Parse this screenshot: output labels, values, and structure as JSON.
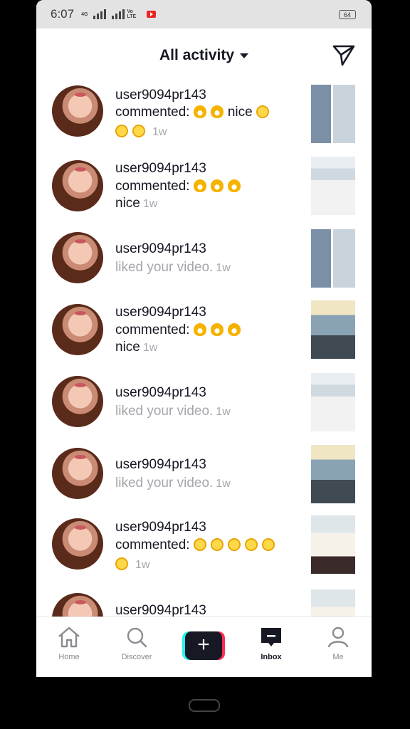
{
  "status_bar": {
    "time": "6:07",
    "network_4g": "4G",
    "volte": "Vo LTE",
    "battery": "64"
  },
  "header": {
    "title": "All activity",
    "icons": [
      "caret-down-icon",
      "send-direct-message-icon"
    ]
  },
  "activities": [
    {
      "username": "user9094pr143",
      "line1": "commented: 👌👌nice 🤣",
      "line2": "🤣🤣",
      "time": "1w"
    },
    {
      "username": "user9094pr143",
      "line1": "commented: 👌👌👌",
      "line2": "nice",
      "time": "1w"
    },
    {
      "username": "user9094pr143",
      "line1": "liked your video.",
      "line2": "",
      "time": "1w"
    },
    {
      "username": "user9094pr143",
      "line1": "commented: 👌👌👌",
      "line2": "nice",
      "time": "1w"
    },
    {
      "username": "user9094pr143",
      "line1": "liked your video.",
      "line2": "",
      "time": "1w"
    },
    {
      "username": "user9094pr143",
      "line1": "liked your video.",
      "line2": "",
      "time": "1w"
    },
    {
      "username": "user9094pr143",
      "line1": "commented: 🤣🤣🤣🤣🤣",
      "line2": "🤣",
      "time": "1w"
    },
    {
      "username": "user9094pr143",
      "line1": "",
      "line2": "",
      "time": ""
    }
  ],
  "nav": {
    "home": "Home",
    "discover": "Discover",
    "inbox": "Inbox",
    "me": "Me"
  },
  "colors": {
    "accent_cyan": "#25f4ee",
    "accent_red": "#fe2c55",
    "text_dark": "#161823",
    "text_grey": "#a4a6ab"
  }
}
